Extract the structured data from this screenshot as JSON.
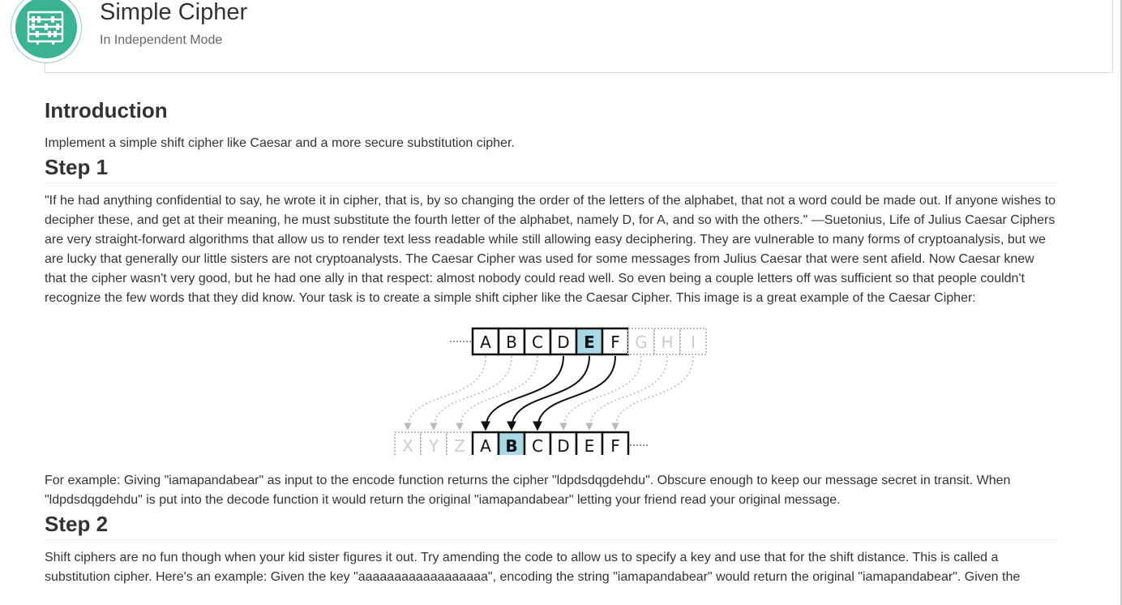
{
  "header": {
    "title": "Simple Cipher",
    "subtitle": "In Independent Mode",
    "logo_icon": "abacus-icon",
    "accent_color": "#3ab395"
  },
  "intro": {
    "heading": "Introduction",
    "text": "Implement a simple shift cipher like Caesar and a more secure substitution cipher."
  },
  "step1": {
    "heading": "Step 1",
    "text": "\"If he had anything confidential to say, he wrote it in cipher, that is, by so changing the order of the letters of the alphabet, that not a word could be made out. If anyone wishes to decipher these, and get at their meaning, he must substitute the fourth letter of the alphabet, namely D, for A, and so with the others.\" —Suetonius, Life of Julius Caesar Ciphers are very straight-forward algorithms that allow us to render text less readable while still allowing easy deciphering. They are vulnerable to many forms of cryptoanalysis, but we are lucky that generally our little sisters are not cryptoanalysts. The Caesar Cipher was used for some messages from Julius Caesar that were sent afield. Now Caesar knew that the cipher wasn't very good, but he had one ally in that respect: almost nobody could read well. So even being a couple letters off was sufficient so that people couldn't recognize the few words that they did know. Your task is to create a simple shift cipher like the Caesar Cipher. This image is a great example of the Caesar Cipher:",
    "diagram": {
      "top_row": [
        "A",
        "B",
        "C",
        "D",
        "E",
        "F"
      ],
      "top_faded": [
        "G",
        "H",
        "I"
      ],
      "bottom_faded": [
        "X",
        "Y",
        "Z"
      ],
      "bottom_row": [
        "A",
        "B",
        "C",
        "D",
        "E",
        "F"
      ],
      "highlight_color": "#a9d8e6"
    },
    "example": "For example: Giving \"iamapandabear\" as input to the encode function returns the cipher \"ldpdsdqgdehdu\". Obscure enough to keep our message secret in transit. When \"ldpdsdqgdehdu\" is put into the decode function it would return the original \"iamapandabear\" letting your friend read your original message."
  },
  "step2": {
    "heading": "Step 2",
    "text": "Shift ciphers are no fun though when your kid sister figures it out. Try amending the code to allow us to specify a key and use that for the shift distance. This is called a substitution cipher. Here's an example: Given the key \"aaaaaaaaaaaaaaaaaa\", encoding the string \"iamapandabear\" would return the original \"iamapandabear\". Given the"
  }
}
